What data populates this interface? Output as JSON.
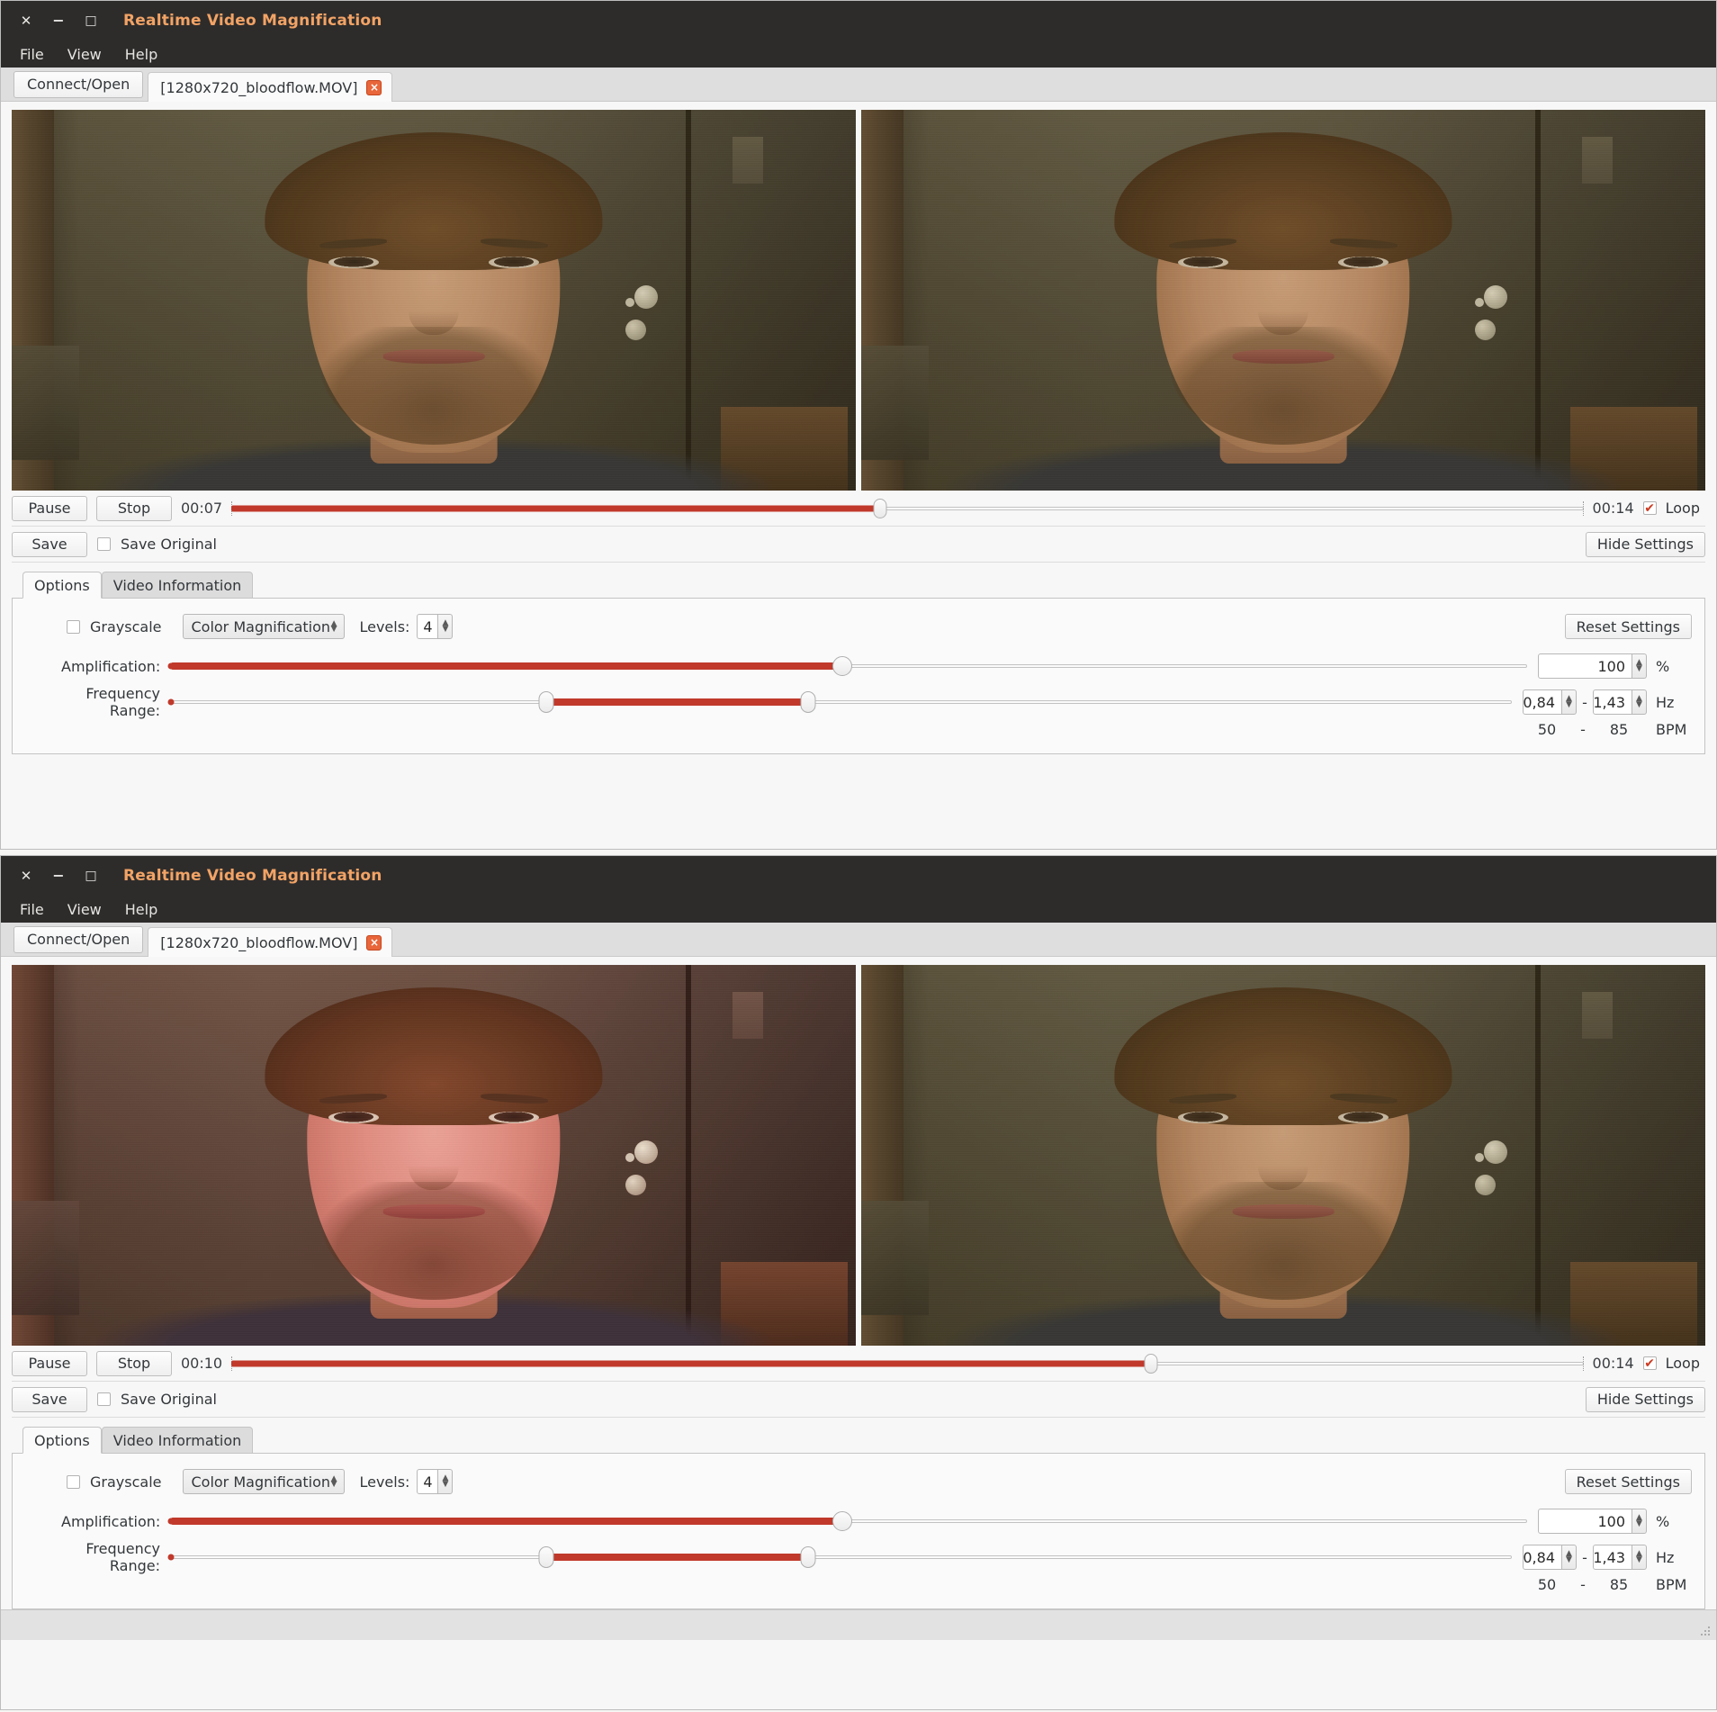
{
  "app": {
    "title": "Realtime Video Magnification",
    "menu": [
      "File",
      "View",
      "Help"
    ],
    "window_buttons": [
      "close-icon",
      "minimize-icon",
      "maximize-icon"
    ]
  },
  "tabs": {
    "connect_open_label": "Connect/Open",
    "video_tab_label": "[1280x720_bloodflow.MOV]",
    "close_tab_icon": "×"
  },
  "colors": {
    "accent_red": "#c0392b",
    "titlebar_bg": "#2e2c2b",
    "titlebar_text": "#f2a365",
    "panel_bg": "#fafafa",
    "tab_close_bg": "#e8663a"
  },
  "windows": [
    {
      "id": "window-top",
      "transport": {
        "pause_label": "Pause",
        "stop_label": "Stop",
        "current_time": "00:07",
        "total_time": "00:14",
        "loop_label": "Loop",
        "loop_checked": true,
        "seek_percent": 48
      },
      "save": {
        "save_label": "Save",
        "save_original_label": "Save Original",
        "save_original_checked": false,
        "hide_settings_label": "Hide Settings"
      },
      "options": {
        "tab_options_label": "Options",
        "tab_video_info_label": "Video Information",
        "grayscale_label": "Grayscale",
        "grayscale_checked": false,
        "mode_value": "Color Magnification",
        "levels_label": "Levels:",
        "levels_value": "4",
        "reset_label": "Reset Settings",
        "amplification_label": "Amplification:",
        "amplification_value": "100",
        "amplification_unit": "%",
        "amplification_percent": 49.5,
        "frequency_label": "Frequency Range:",
        "frequency_low": "0,84",
        "frequency_high": "1,43",
        "frequency_unit": "Hz",
        "frequency_low_percent": 28,
        "frequency_high_percent": 47.5,
        "bpm_low": "50",
        "bpm_high": "85",
        "bpm_unit": "BPM",
        "range_dash": "-"
      },
      "video": {
        "left_panel_name": "magnified-video-view",
        "right_panel_name": "original-video-view",
        "left_tint": "none",
        "right_tint": "none"
      }
    },
    {
      "id": "window-bottom",
      "transport": {
        "pause_label": "Pause",
        "stop_label": "Stop",
        "current_time": "00:10",
        "total_time": "00:14",
        "loop_label": "Loop",
        "loop_checked": true,
        "seek_percent": 68
      },
      "save": {
        "save_label": "Save",
        "save_original_label": "Save Original",
        "save_original_checked": false,
        "hide_settings_label": "Hide Settings"
      },
      "options": {
        "tab_options_label": "Options",
        "tab_video_info_label": "Video Information",
        "grayscale_label": "Grayscale",
        "grayscale_checked": false,
        "mode_value": "Color Magnification",
        "levels_label": "Levels:",
        "levels_value": "4",
        "reset_label": "Reset Settings",
        "amplification_label": "Amplification:",
        "amplification_value": "100",
        "amplification_unit": "%",
        "amplification_percent": 49.5,
        "frequency_label": "Frequency Range:",
        "frequency_low": "0,84",
        "frequency_high": "1,43",
        "frequency_unit": "Hz",
        "frequency_low_percent": 28,
        "frequency_high_percent": 47.5,
        "bpm_low": "50",
        "bpm_high": "85",
        "bpm_unit": "BPM",
        "range_dash": "-"
      },
      "video": {
        "left_panel_name": "magnified-video-view",
        "right_panel_name": "original-video-view",
        "left_tint": "red-magnified",
        "right_tint": "none"
      }
    }
  ]
}
